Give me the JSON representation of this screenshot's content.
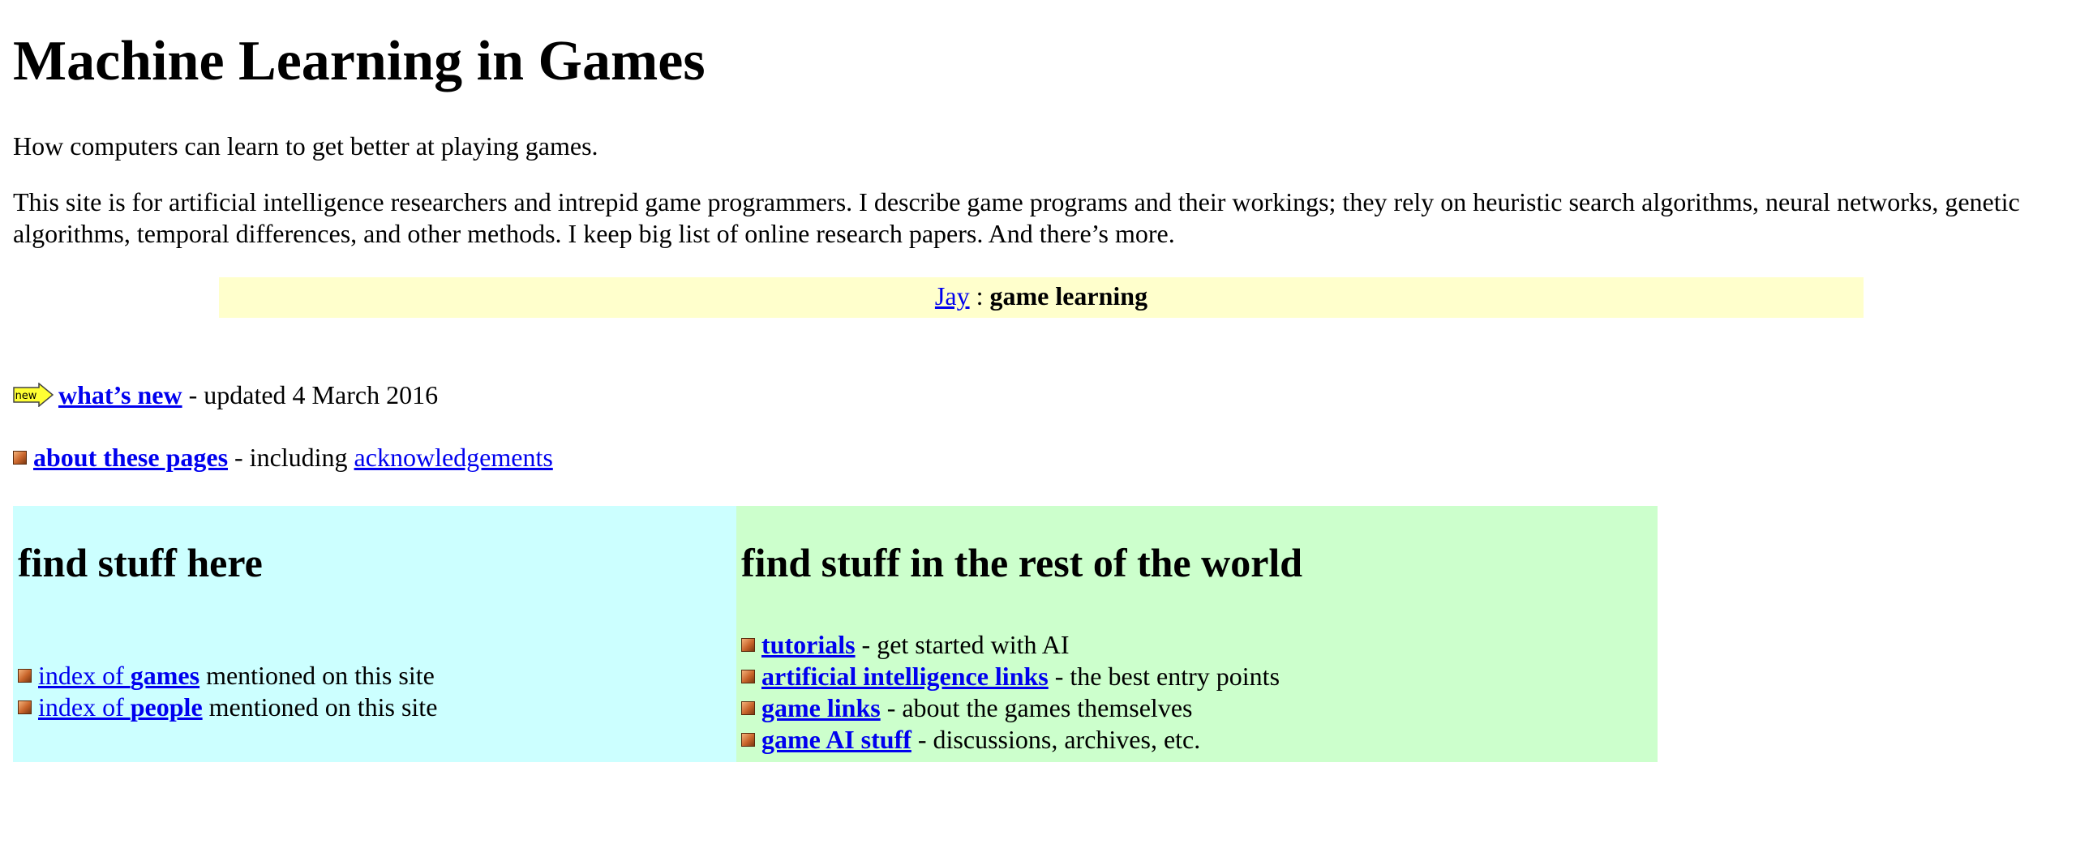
{
  "header": {
    "title": "Machine Learning in Games",
    "tagline": "How computers can learn to get better at playing games.",
    "intro": "This site is for artificial intelligence researchers and intrepid game programmers. I describe game programs and their workings; they rely on heuristic search algorithms, neural networks, genetic algorithms, temporal differences, and other methods. I keep big list of online research papers. And there’s more."
  },
  "banner": {
    "author_link": "Jay",
    "separator": " : ",
    "section": "game learning"
  },
  "news": {
    "icon_label": "new",
    "link": "what’s new",
    "suffix": " - updated 4 March 2016"
  },
  "about": {
    "link": "about these pages",
    "middle": " - including ",
    "ack_link": "acknowledgements"
  },
  "left_panel": {
    "heading": "find stuff here",
    "items": [
      {
        "prefix": "index of ",
        "bold": "games",
        "suffix": " mentioned on this site"
      },
      {
        "prefix": "index of ",
        "bold": "people",
        "suffix": " mentioned on this site"
      }
    ]
  },
  "right_panel": {
    "heading": "find stuff in the rest of the world",
    "items": [
      {
        "link": "tutorials",
        "suffix": " - get started with AI"
      },
      {
        "link": "artificial intelligence links",
        "suffix": " - the best entry points"
      },
      {
        "link": "game links",
        "suffix": " - about the games themselves"
      },
      {
        "link": "game AI stuff",
        "suffix": " - discussions, archives, etc."
      }
    ]
  },
  "colors": {
    "banner_bg": "#ffffcc",
    "left_panel_bg": "#ccffff",
    "right_panel_bg": "#ccffcc",
    "link": "#0000ee"
  }
}
